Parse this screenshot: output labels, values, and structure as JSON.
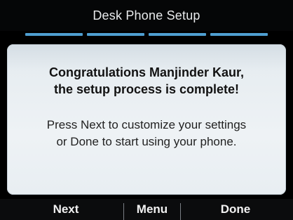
{
  "header": {
    "title": "Desk Phone Setup"
  },
  "progress": {
    "segments_total": 4,
    "segments_complete": 4,
    "segment_color": "#4e9ed0"
  },
  "dialog": {
    "title_line1": "Congratulations Manjinder Kaur,",
    "title_line2": "the setup process is complete!",
    "body_line1": "Press Next to customize your settings",
    "body_line2": "or Done to start using your phone."
  },
  "softkeys": {
    "next": "Next",
    "menu": "Menu",
    "done": "Done"
  }
}
